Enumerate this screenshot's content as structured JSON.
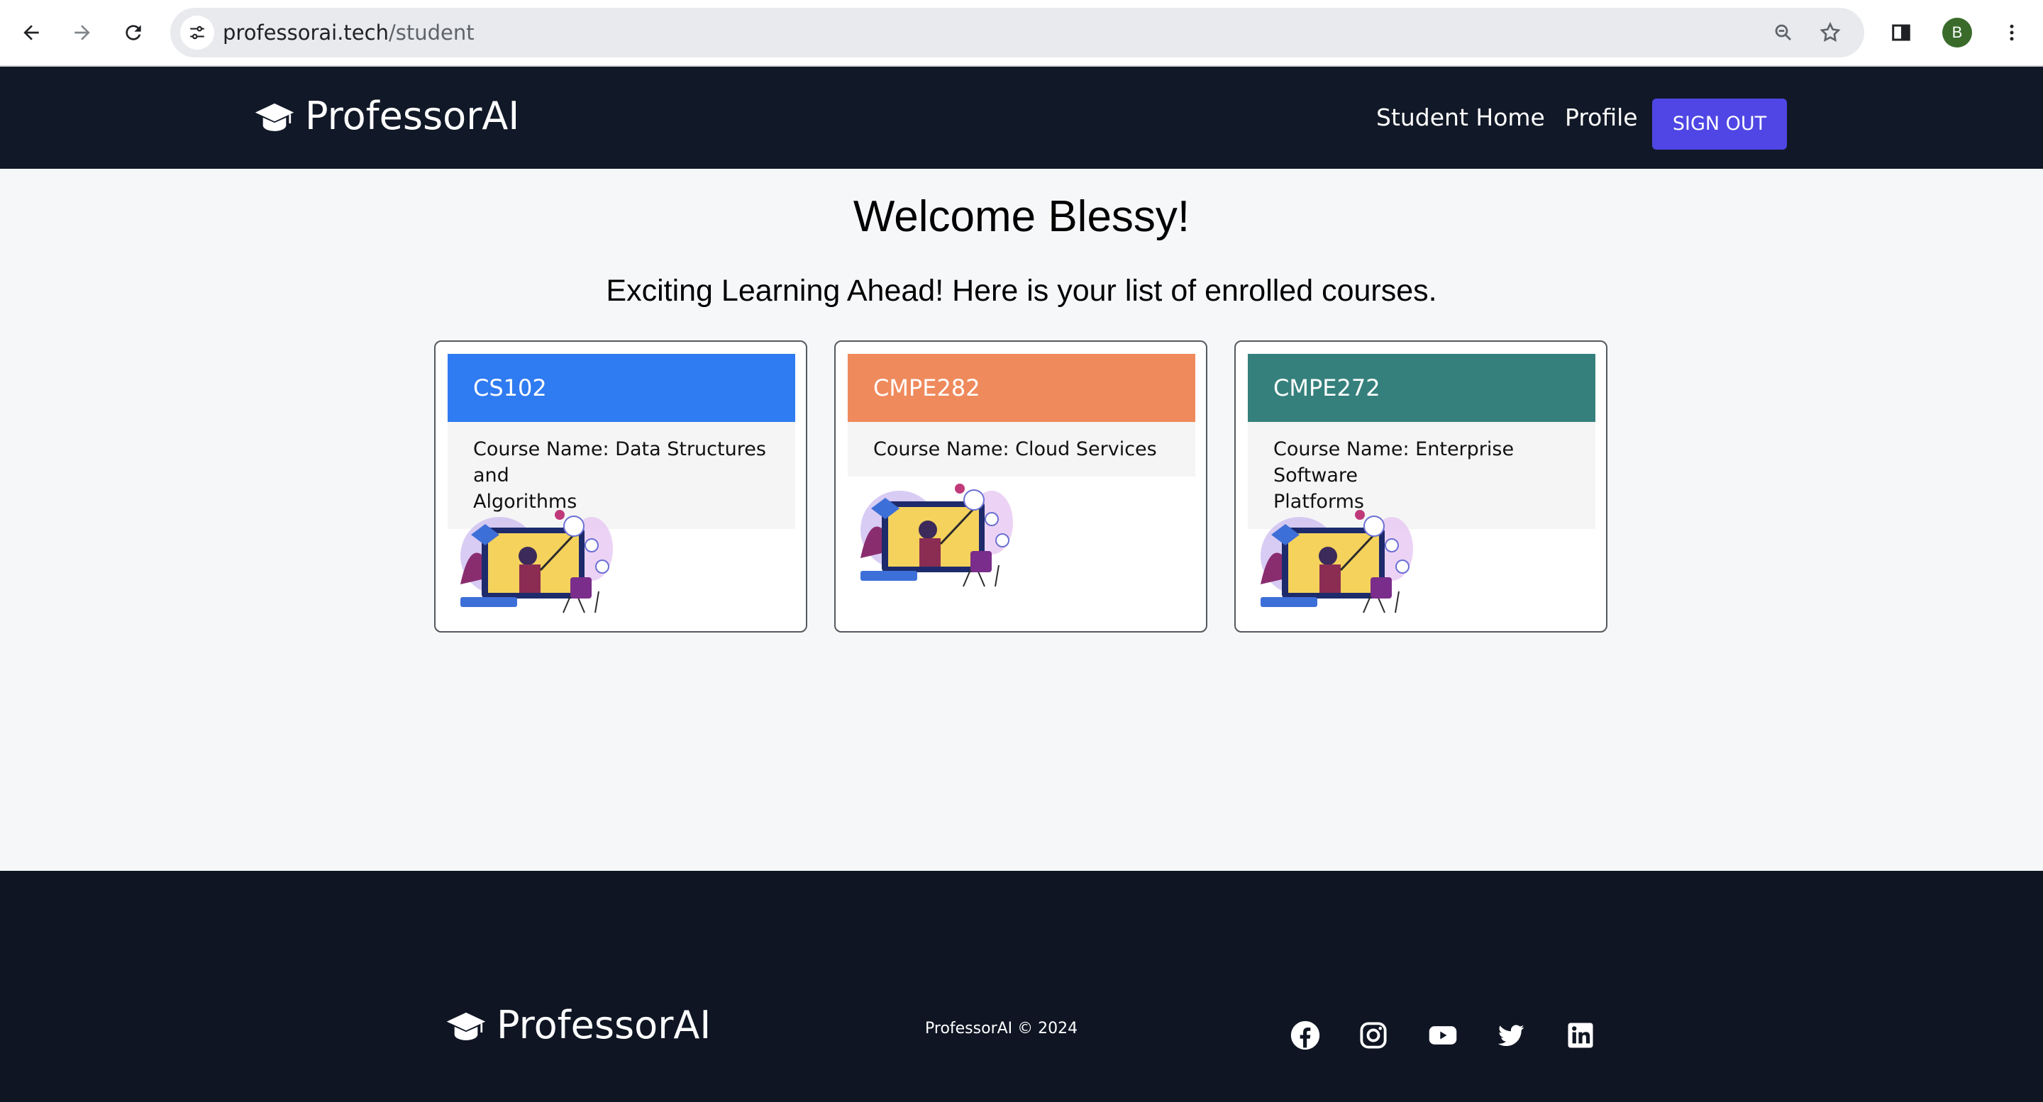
{
  "browser": {
    "url_domain": "professorai.tech",
    "url_path": "/student",
    "profile_initial": "B"
  },
  "header": {
    "brand": "ProfessorAI",
    "nav": [
      "Student Home",
      "Profile"
    ],
    "signout_label": "SIGN OUT"
  },
  "main": {
    "welcome": "Welcome Blessy!",
    "subtitle": "Exciting Learning Ahead! Here is your list of enrolled courses.",
    "courses": [
      {
        "code": "CS102",
        "name_line1": "Course Name: Data Structures and",
        "name_line2": "Algorithms",
        "color": "#2f7bf1"
      },
      {
        "code": "CMPE282",
        "name_line1": "Course Name: Cloud Services",
        "name_line2": "",
        "color": "#ef8a5c"
      },
      {
        "code": "CMPE272",
        "name_line1": "Course Name: Enterprise Software",
        "name_line2": "Platforms",
        "color": "#35807c"
      }
    ]
  },
  "footer": {
    "brand": "ProfessorAI",
    "copyright": "ProfessorAI © 2024",
    "social": [
      "facebook-icon",
      "instagram-icon",
      "youtube-icon",
      "twitter-icon",
      "linkedin-icon"
    ]
  },
  "colors": {
    "header_bg": "#111827",
    "footer_bg": "#0f1523",
    "signout_bg": "#4f46e5",
    "page_bg": "#f6f7f9"
  }
}
